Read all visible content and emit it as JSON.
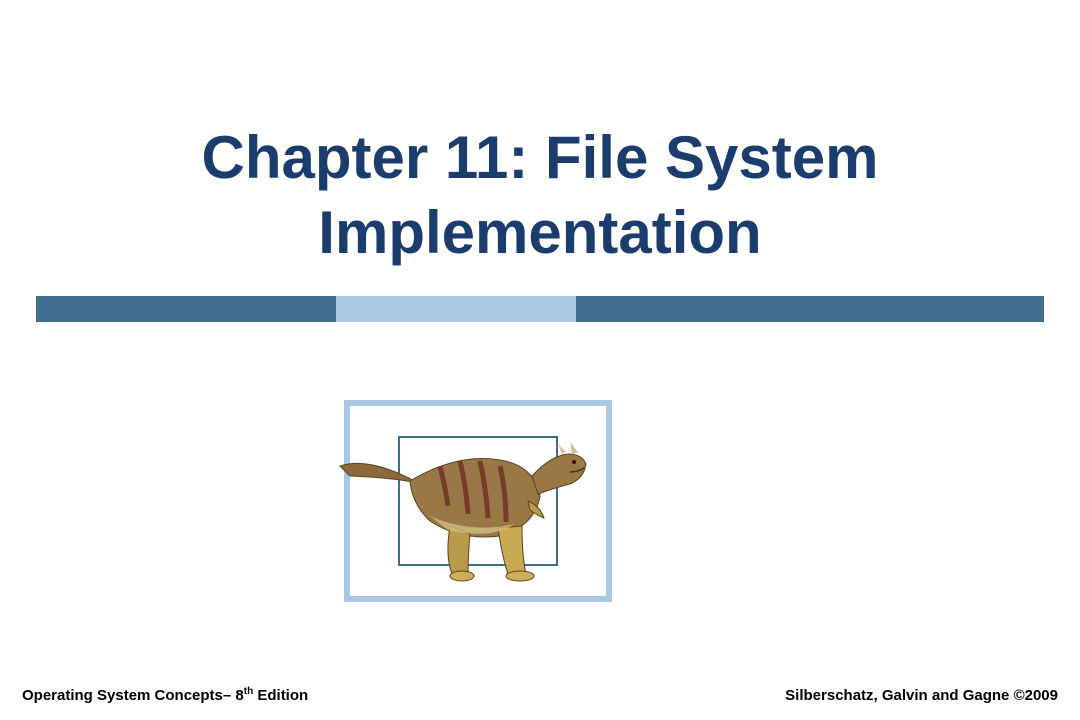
{
  "title_line1": "Chapter 11:  File System",
  "title_line2": "Implementation",
  "footer": {
    "book_prefix": "Operating System Concepts– 8",
    "book_sup": "th",
    "book_suffix": " Edition",
    "credits": "Silberschatz, Galvin and Gagne ©2009"
  },
  "colors": {
    "title": "#1a3d6d",
    "bar_dark": "#3f6e8c",
    "bar_light": "#a8c8e4"
  },
  "image": {
    "semantic": "dinosaur-illustration"
  }
}
